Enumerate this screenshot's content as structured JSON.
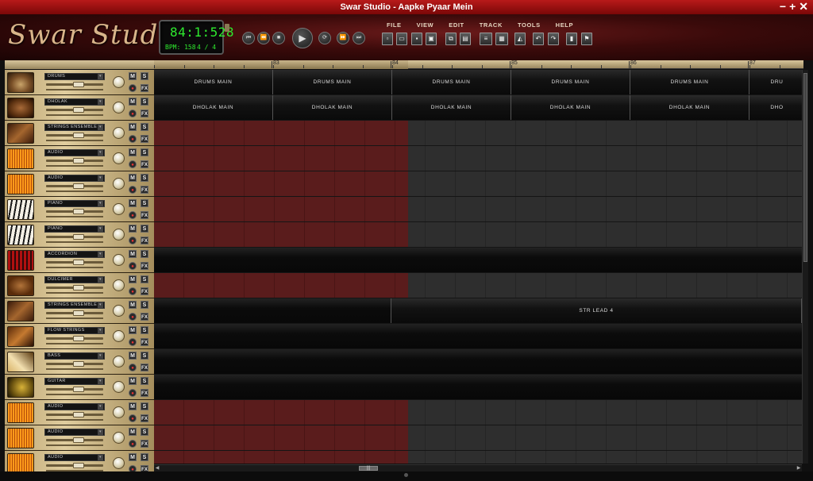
{
  "app": {
    "title": "Swar Studio - Aapke Pyaar Mein",
    "logo_text": "Swar Studio",
    "window_controls": [
      "−",
      "+",
      "✕"
    ]
  },
  "display": {
    "time": "84:1:528",
    "bpm": "BPM: 158",
    "time_signature": "4 / 4"
  },
  "transport": {
    "rewind_start": "⏮",
    "rewind": "⏪",
    "stop": "■",
    "play": "▶",
    "loop": "⟳",
    "forward": "⏩",
    "forward_end": "⏭"
  },
  "menu": [
    "FILE",
    "VIEW",
    "EDIT",
    "TRACK",
    "TOOLS",
    "HELP"
  ],
  "toolbar_icons": [
    "new-file-icon",
    "open-icon",
    "save-icon",
    "save-as-icon",
    "copy-icon",
    "paste-icon",
    "mixer-icon",
    "piano-roll-icon",
    "metronome-icon",
    "undo-icon",
    "redo-icon",
    "marker-icon",
    "flag-icon"
  ],
  "ruler": {
    "markers": [
      "83",
      "84",
      "85",
      "86",
      "87"
    ]
  },
  "tracks": [
    {
      "name": "DRUMS",
      "thumb": "drums",
      "clips": [
        "DRUMS MAIN",
        "DRUMS MAIN",
        "DRUMS MAIN",
        "DRUMS MAIN",
        "DRUMS MAIN",
        "DRU"
      ],
      "mode": "clips"
    },
    {
      "name": "DHOLAK",
      "thumb": "dholak",
      "clips": [
        "DHOLAK MAIN",
        "DHOLAK MAIN",
        "DHOLAK MAIN",
        "DHOLAK MAIN",
        "DHOLAK MAIN",
        "DHO"
      ],
      "mode": "clips"
    },
    {
      "name": "STRINGS ENSEMBLE",
      "thumb": "strings",
      "mode": "empty"
    },
    {
      "name": "AUDIO",
      "thumb": "audio",
      "mode": "empty"
    },
    {
      "name": "AUDIO",
      "thumb": "audio",
      "mode": "empty"
    },
    {
      "name": "PIANO",
      "thumb": "piano",
      "mode": "empty"
    },
    {
      "name": "PIANO",
      "thumb": "piano",
      "mode": "empty"
    },
    {
      "name": "ACCORDION",
      "thumb": "accordion",
      "mode": "full"
    },
    {
      "name": "DULCIMER",
      "thumb": "dulcimer",
      "mode": "empty"
    },
    {
      "name": "STRINGS ENSEMBLE",
      "thumb": "strings",
      "mode": "partial",
      "clip_label": "STR LEAD 4"
    },
    {
      "name": "FLOW STRINGS",
      "thumb": "flow",
      "mode": "full"
    },
    {
      "name": "BASS",
      "thumb": "bass",
      "mode": "full"
    },
    {
      "name": "GUITAR",
      "thumb": "guitar",
      "mode": "full"
    },
    {
      "name": "AUDIO",
      "thumb": "audio",
      "mode": "empty"
    },
    {
      "name": "AUDIO",
      "thumb": "audio",
      "mode": "empty"
    },
    {
      "name": "AUDIO",
      "thumb": "audio",
      "mode": "empty"
    }
  ],
  "track_buttons": {
    "mute": "M",
    "solo": "S",
    "record": "●",
    "fx": "FX"
  },
  "scroll": {
    "grip": "|||",
    "left": "◀",
    "right": "▶"
  }
}
